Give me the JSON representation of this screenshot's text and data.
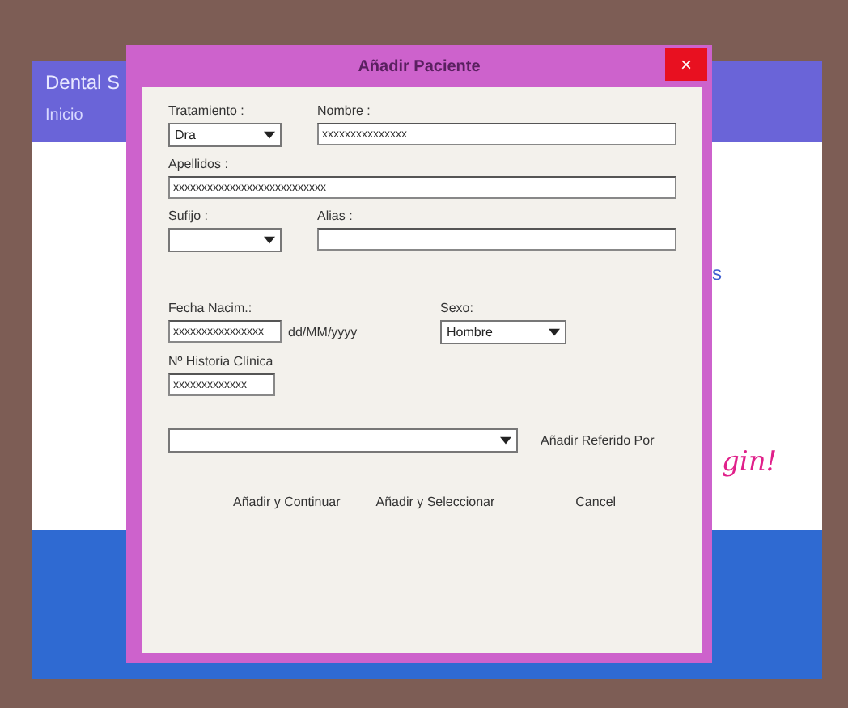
{
  "app": {
    "title": "Dental S",
    "nav": "Inicio",
    "side_text": "s",
    "banner_text": "gin!"
  },
  "dialog": {
    "title": "Añadir Paciente",
    "close": "×",
    "tratamiento": {
      "label": "Tratamiento :",
      "value": "Dra"
    },
    "nombre": {
      "label": "Nombre :",
      "value": "xxxxxxxxxxxxxxx"
    },
    "apellidos": {
      "label": "Apellidos :",
      "value": "xxxxxxxxxxxxxxxxxxxxxxxxxxx"
    },
    "sufijo": {
      "label": "Sufijo :"
    },
    "alias": {
      "label": "Alias :"
    },
    "fecha": {
      "label": "Fecha Nacim.:",
      "value": "xxxxxxxxxxxxxxxx",
      "hint": "dd/MM/yyyy"
    },
    "sexo": {
      "label": "Sexo:",
      "value": "Hombre"
    },
    "historia": {
      "label": "Nº Historia Clínica",
      "value": "xxxxxxxxxxxxx"
    },
    "referido": {
      "label": "Añadir Referido Por"
    },
    "buttons": [
      "Añadir y Continuar",
      "Añadir y Seleccionar",
      "Cancel"
    ]
  }
}
